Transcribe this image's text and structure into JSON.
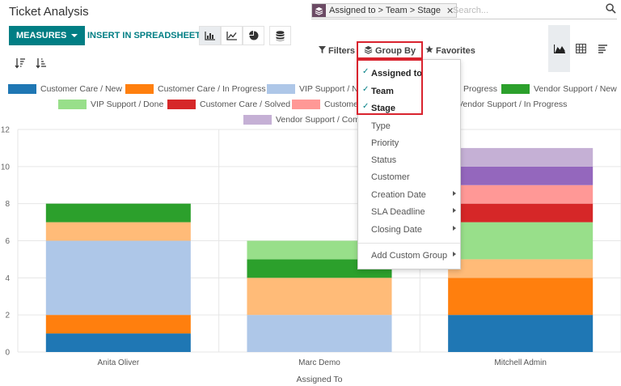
{
  "title": "Ticket Analysis",
  "search": {
    "facet_text": "Assigned to > Team > Stage",
    "placeholder": "Search..."
  },
  "toolbar": {
    "measures_label": "MEASURES",
    "spreadsheet_label": "INSERT IN SPREADSHEET",
    "chart_types": [
      "bar-chart-icon",
      "line-chart-icon",
      "pie-chart-icon"
    ],
    "active_chart_type": "bar-chart-icon"
  },
  "filterbar": {
    "filters_label": "Filters",
    "groupby_label": "Group By",
    "favorites_label": "Favorites"
  },
  "groupby_menu": {
    "selected": [
      "Assigned to",
      "Team",
      "Stage"
    ],
    "options": [
      "Type",
      "Priority",
      "Status",
      "Customer",
      "Creation Date",
      "SLA Deadline",
      "Closing Date"
    ],
    "submenu_options": [
      "Creation Date",
      "SLA Deadline",
      "Closing Date"
    ],
    "add_custom": "Add Custom Group"
  },
  "legend": [
    {
      "label": "Customer Care / New",
      "color": "#1f77b4"
    },
    {
      "label": "Customer Care / In Progress",
      "color": "#ff7f0e"
    },
    {
      "label": "VIP Support / Ne",
      "color": "#aec7e8"
    },
    {
      "label": "Progress",
      "color": ""
    },
    {
      "label": "Vendor Support / New",
      "color": "#2ca02c"
    },
    {
      "label": "VIP Support / Done",
      "color": "#98df8a"
    },
    {
      "label": "Customer Care / Solved",
      "color": "#d62728"
    },
    {
      "label": "Custome",
      "color": "#ff9896"
    },
    {
      "label": "Vendor Support / In Progress",
      "color": ""
    },
    {
      "label": "Vendor Support / Comp",
      "color": "#c5b0d5"
    }
  ],
  "chart_data": {
    "type": "bar",
    "stacked": true,
    "categories": [
      "Anita Oliver",
      "Marc Demo",
      "Mitchell Admin"
    ],
    "xlabel": "Assigned To",
    "ylabel": "",
    "ylim": [
      0,
      12
    ],
    "yticks": [
      0,
      2,
      4,
      6,
      8,
      10,
      12
    ],
    "grid": true,
    "segments": [
      [
        {
          "value": 1,
          "color": "#1f77b4"
        },
        {
          "value": 1,
          "color": "#ff7f0e"
        },
        {
          "value": 4,
          "color": "#aec7e8"
        },
        {
          "value": 1,
          "color": "#ffbb78"
        },
        {
          "value": 1,
          "color": "#2ca02c"
        }
      ],
      [
        {
          "value": 2,
          "color": "#aec7e8"
        },
        {
          "value": 2,
          "color": "#ffbb78"
        },
        {
          "value": 1,
          "color": "#2ca02c"
        },
        {
          "value": 1,
          "color": "#98df8a"
        }
      ],
      [
        {
          "value": 2,
          "color": "#1f77b4"
        },
        {
          "value": 2,
          "color": "#ff7f0e"
        },
        {
          "value": 1,
          "color": "#ffbb78"
        },
        {
          "value": 2,
          "color": "#98df8a"
        },
        {
          "value": 1,
          "color": "#d62728"
        },
        {
          "value": 1,
          "color": "#ff9896"
        },
        {
          "value": 1,
          "color": "#9467bd"
        },
        {
          "value": 1,
          "color": "#c5b0d5"
        }
      ]
    ]
  }
}
